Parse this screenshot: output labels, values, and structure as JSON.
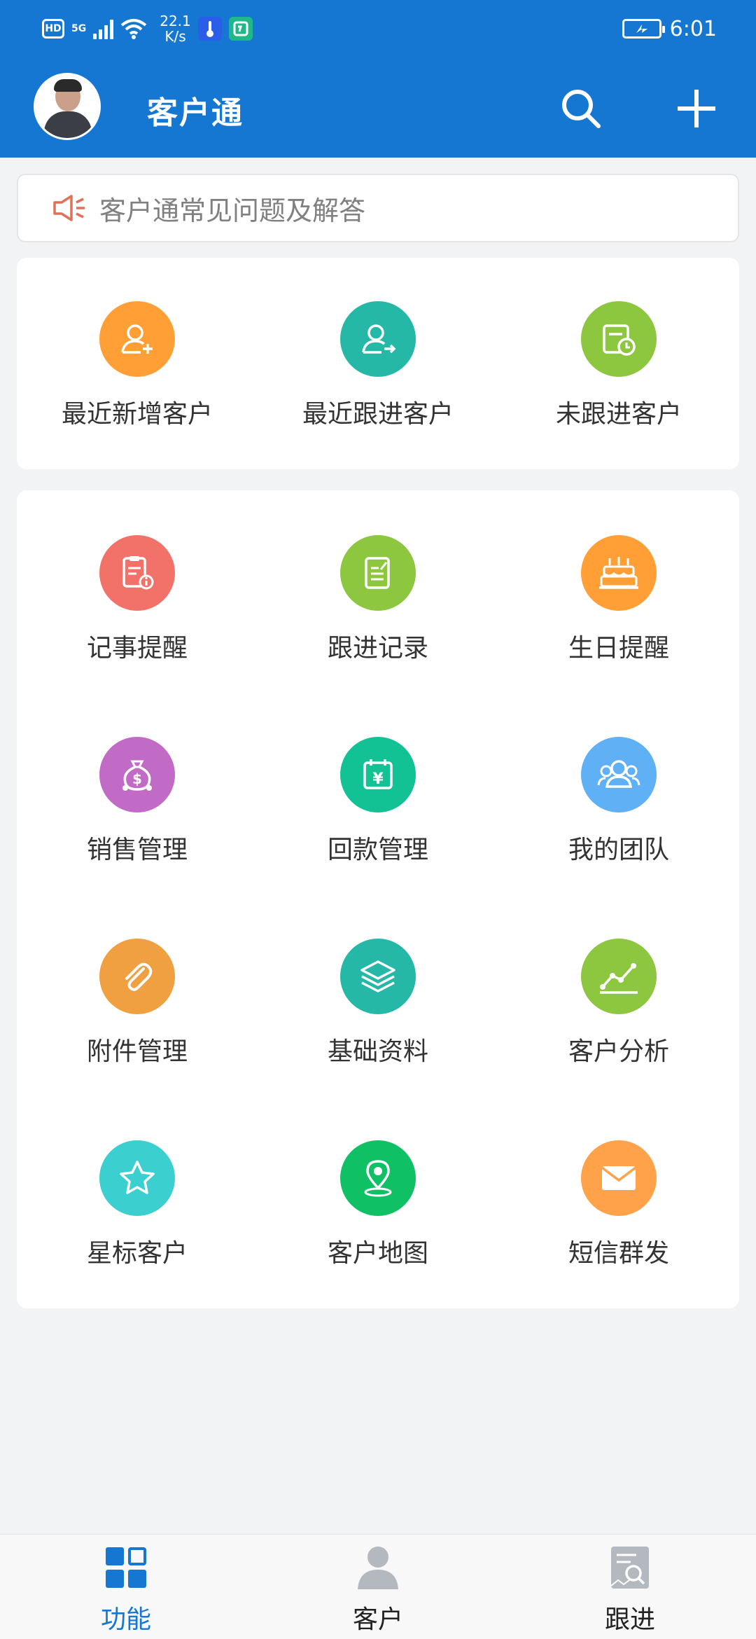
{
  "status_bar": {
    "hd": "HD",
    "network": "5G",
    "speed_top": "22.1",
    "speed_bottom": "K/s",
    "time": "6:01"
  },
  "header": {
    "title": "客户通",
    "bg_color": "#1677d2"
  },
  "notice": {
    "text": "客户通常见问题及解答"
  },
  "quick_items": [
    {
      "label": "最近新增客户",
      "icon": "user-add-icon",
      "color": "#ff9f36"
    },
    {
      "label": "最近跟进客户",
      "icon": "user-follow-icon",
      "color": "#26b8a6"
    },
    {
      "label": "未跟进客户",
      "icon": "calendar-clock-icon",
      "color": "#8dc63f"
    }
  ],
  "features": [
    {
      "label": "记事提醒",
      "icon": "clipboard-info-icon",
      "color": "#f2726a"
    },
    {
      "label": "跟进记录",
      "icon": "edit-record-icon",
      "color": "#8dc63f"
    },
    {
      "label": "生日提醒",
      "icon": "cake-icon",
      "color": "#ff9f36"
    },
    {
      "label": "销售管理",
      "icon": "money-bag-icon",
      "color": "#c26bc6"
    },
    {
      "label": "回款管理",
      "icon": "yuan-calendar-icon",
      "color": "#12c295"
    },
    {
      "label": "我的团队",
      "icon": "team-icon",
      "color": "#5fb0f5"
    },
    {
      "label": "附件管理",
      "icon": "paperclip-icon",
      "color": "#f0a040"
    },
    {
      "label": "基础资料",
      "icon": "layers-icon",
      "color": "#26b8a6"
    },
    {
      "label": "客户分析",
      "icon": "line-chart-icon",
      "color": "#8dc63f"
    },
    {
      "label": "星标客户",
      "icon": "star-icon",
      "color": "#3ccfcf"
    },
    {
      "label": "客户地图",
      "icon": "map-pin-icon",
      "color": "#10c065"
    },
    {
      "label": "短信群发",
      "icon": "envelope-icon",
      "color": "#ffa24a"
    }
  ],
  "bottom_nav": [
    {
      "label": "功能",
      "icon": "grid-icon",
      "active": true
    },
    {
      "label": "客户",
      "icon": "person-icon",
      "active": false
    },
    {
      "label": "跟进",
      "icon": "follow-doc-icon",
      "active": false
    }
  ]
}
